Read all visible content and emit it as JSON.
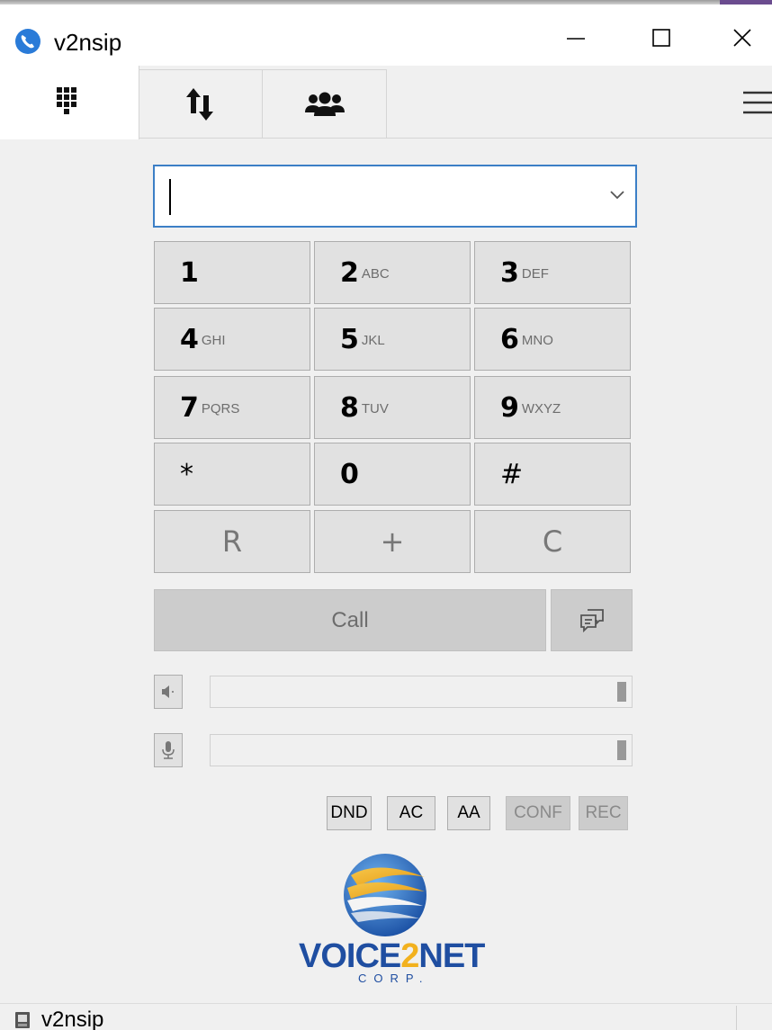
{
  "window": {
    "title": "v2nsip",
    "controls": [
      "minimize",
      "maximize",
      "close"
    ]
  },
  "tabs": [
    {
      "id": "dialpad",
      "icon": "dialpad-icon",
      "active": true
    },
    {
      "id": "calls",
      "icon": "call-transfer-icon",
      "active": false
    },
    {
      "id": "contacts",
      "icon": "contacts-icon",
      "active": false
    }
  ],
  "dial_input": {
    "value": "",
    "placeholder": ""
  },
  "keypad": [
    {
      "digit": "1",
      "letters": ""
    },
    {
      "digit": "2",
      "letters": "ABC"
    },
    {
      "digit": "3",
      "letters": "DEF"
    },
    {
      "digit": "4",
      "letters": "GHI"
    },
    {
      "digit": "5",
      "letters": "JKL"
    },
    {
      "digit": "6",
      "letters": "MNO"
    },
    {
      "digit": "7",
      "letters": "PQRS"
    },
    {
      "digit": "8",
      "letters": "TUV"
    },
    {
      "digit": "9",
      "letters": "WXYZ"
    },
    {
      "digit": "*",
      "letters": ""
    },
    {
      "digit": "0",
      "letters": ""
    },
    {
      "digit": "#",
      "letters": ""
    }
  ],
  "function_keys": {
    "redial": "R",
    "plus": "+",
    "clear": "C"
  },
  "call": {
    "label": "Call",
    "enabled": false
  },
  "speaker_volume": {
    "level": 1.0
  },
  "mic_volume": {
    "level": 1.0
  },
  "toggles": {
    "dnd": "DND",
    "ac": "AC",
    "aa": "AA",
    "conf": "CONF",
    "rec": "REC"
  },
  "logo": {
    "line1_a": "VOICE",
    "line1_b": "2",
    "line1_c": "NET",
    "line2": "CORP."
  },
  "statusbar": {
    "text": "v2nsip"
  },
  "colors": {
    "accent_blue": "#3c7fc6",
    "key_bg": "#e1e1e1",
    "disabled_bg": "#cccccc",
    "logo_blue": "#1f4ea1",
    "logo_gold": "#f2b11e"
  }
}
